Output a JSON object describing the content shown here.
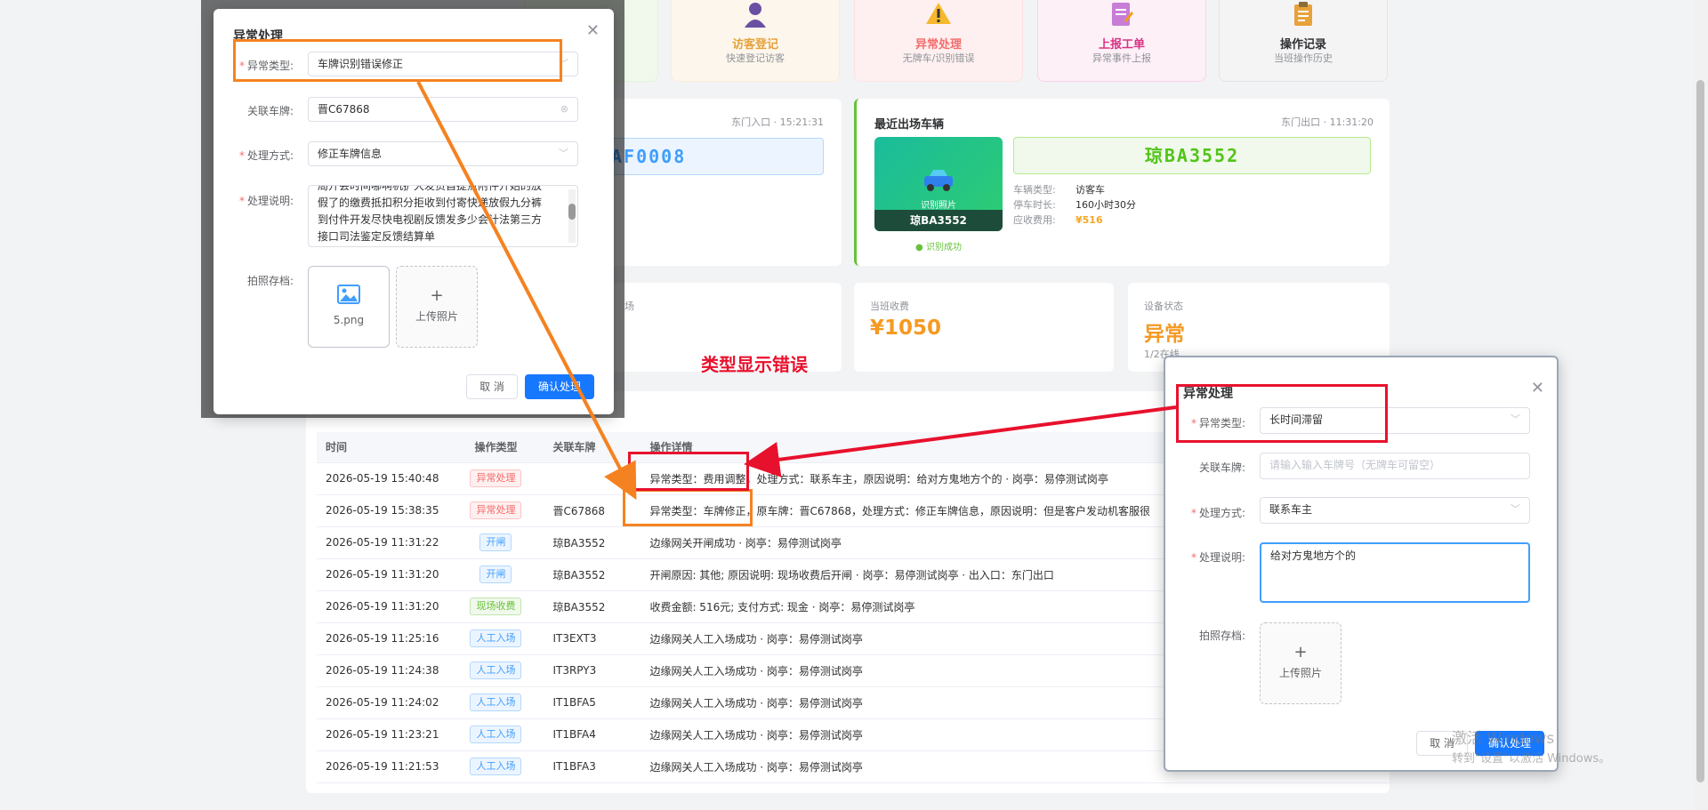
{
  "quick_actions": [
    {
      "title": "访客登记",
      "sub": "快速登记访客",
      "icon": "visitor-icon"
    },
    {
      "title": "异常处理",
      "sub": "无牌车/识别错误",
      "icon": "warning-icon"
    },
    {
      "title": "上报工单",
      "sub": "异常事件上报",
      "icon": "work-order-icon"
    },
    {
      "title": "操作记录",
      "sub": "当班操作历史",
      "icon": "clipboard-icon"
    }
  ],
  "entry_card": {
    "gate_time": "东门入口 · 15:21:31",
    "plate": "AF0008"
  },
  "exit_card": {
    "title": "最近出场车辆",
    "gate_time": "东门出口 · 11:31:20",
    "photo_label": "识别照片",
    "photo_plate": "琼BA3552",
    "recog_status": "● 识别成功",
    "plate": "琼BA3552",
    "info": [
      {
        "k": "车辆类型:",
        "v": "访客车"
      },
      {
        "k": "停车时长:",
        "v": "160小时30分"
      },
      {
        "k": "应收费用:",
        "v": "¥516"
      }
    ]
  },
  "stats": {
    "partial_label": "场",
    "shift_label": "当班收费",
    "shift_value": "¥1050",
    "device_label": "设备状态",
    "device_value": "异常",
    "device_sub": "1/2在线"
  },
  "annotation": "类型显示错误",
  "table": {
    "headers": [
      "时间",
      "操作类型",
      "关联车牌",
      "操作详情"
    ],
    "rows": [
      {
        "time": "2026-05-19 15:40:48",
        "type": "异常处理",
        "tag": "red",
        "plate": "",
        "detail": "异常类型：费用调整，处理方式：联系车主，原因说明：给对方鬼地方个的 · 岗亭：易停测试岗亭"
      },
      {
        "time": "2026-05-19 15:38:35",
        "type": "异常处理",
        "tag": "red",
        "plate": "晋C67868",
        "detail": "异常类型：车牌修正，原车牌：晋C67868，处理方式：修正车牌信息，原因说明：但是客户发动机客服很"
      },
      {
        "time": "2026-05-19 11:31:22",
        "type": "开闸",
        "tag": "blue",
        "plate": "琼BA3552",
        "detail": "边缘网关开闸成功 · 岗亭：易停测试岗亭"
      },
      {
        "time": "2026-05-19 11:31:20",
        "type": "开闸",
        "tag": "blue",
        "plate": "琼BA3552",
        "detail": "开闸原因: 其他; 原因说明: 现场收费后开闸 · 岗亭：易停测试岗亭 · 出入口：东门出口"
      },
      {
        "time": "2026-05-19 11:31:20",
        "type": "现场收费",
        "tag": "green",
        "plate": "琼BA3552",
        "detail": "收费金额: 516元; 支付方式: 现金 · 岗亭：易停测试岗亭"
      },
      {
        "time": "2026-05-19 11:25:16",
        "type": "人工入场",
        "tag": "blue",
        "plate": "IT3EXT3",
        "detail": "边缘网关人工入场成功 · 岗亭：易停测试岗亭"
      },
      {
        "time": "2026-05-19 11:24:38",
        "type": "人工入场",
        "tag": "blue",
        "plate": "IT3RPY3",
        "detail": "边缘网关人工入场成功 · 岗亭：易停测试岗亭"
      },
      {
        "time": "2026-05-19 11:24:02",
        "type": "人工入场",
        "tag": "blue",
        "plate": "IT1BFA5",
        "detail": "边缘网关人工入场成功 · 岗亭：易停测试岗亭"
      },
      {
        "time": "2026-05-19 11:23:21",
        "type": "人工入场",
        "tag": "blue",
        "plate": "IT1BFA4",
        "detail": "边缘网关人工入场成功 · 岗亭：易停测试岗亭"
      },
      {
        "time": "2026-05-19 11:21:53",
        "type": "人工入场",
        "tag": "blue",
        "plate": "IT1BFA3",
        "detail": "边缘网关人工入场成功 · 岗亭：易停测试岗亭"
      }
    ]
  },
  "dialog_left": {
    "title": "异常处理",
    "type_label": "异常类型:",
    "type_value": "车牌识别错误修正",
    "plate_label": "关联车牌:",
    "plate_value": "晋C67868",
    "method_label": "处理方式:",
    "method_value": "修正车牌信息",
    "desc_label": "处理说明:",
    "desc_lines": [
      "局开会时间哪啊机扩大发货自提点附件开始的放",
      "假了的缴费抵扣积分拒收到付寄快递放假九分裤",
      "到付件开发尽快电视剧反馈发多少会计法第三方",
      "接口司法鉴定反馈结算单"
    ],
    "photo_label": "拍照存档:",
    "photo_file": "5.png",
    "upload_label": "上传照片",
    "cancel": "取 消",
    "confirm": "确认处理"
  },
  "dialog_right": {
    "title": "异常处理",
    "type_label": "异常类型:",
    "type_value": "长时间滞留",
    "plate_label": "关联车牌:",
    "plate_placeholder": "请输入输入车牌号（无牌车可留空）",
    "method_label": "处理方式:",
    "method_value": "联系车主",
    "desc_label": "处理说明:",
    "desc_value": "给对方鬼地方个的",
    "photo_label": "拍照存档:",
    "upload_label": "上传照片",
    "cancel": "取 消",
    "confirm": "确认处理"
  },
  "watermark": {
    "line1": "激活 Windows",
    "line2": "转到\"设置\"以激活 Windows。"
  },
  "colors": {
    "orange_highlight": "#f58220",
    "red_highlight": "#e8112d",
    "primary": "#1677ff",
    "danger": "#f56c6c",
    "warning": "#f59a23"
  }
}
